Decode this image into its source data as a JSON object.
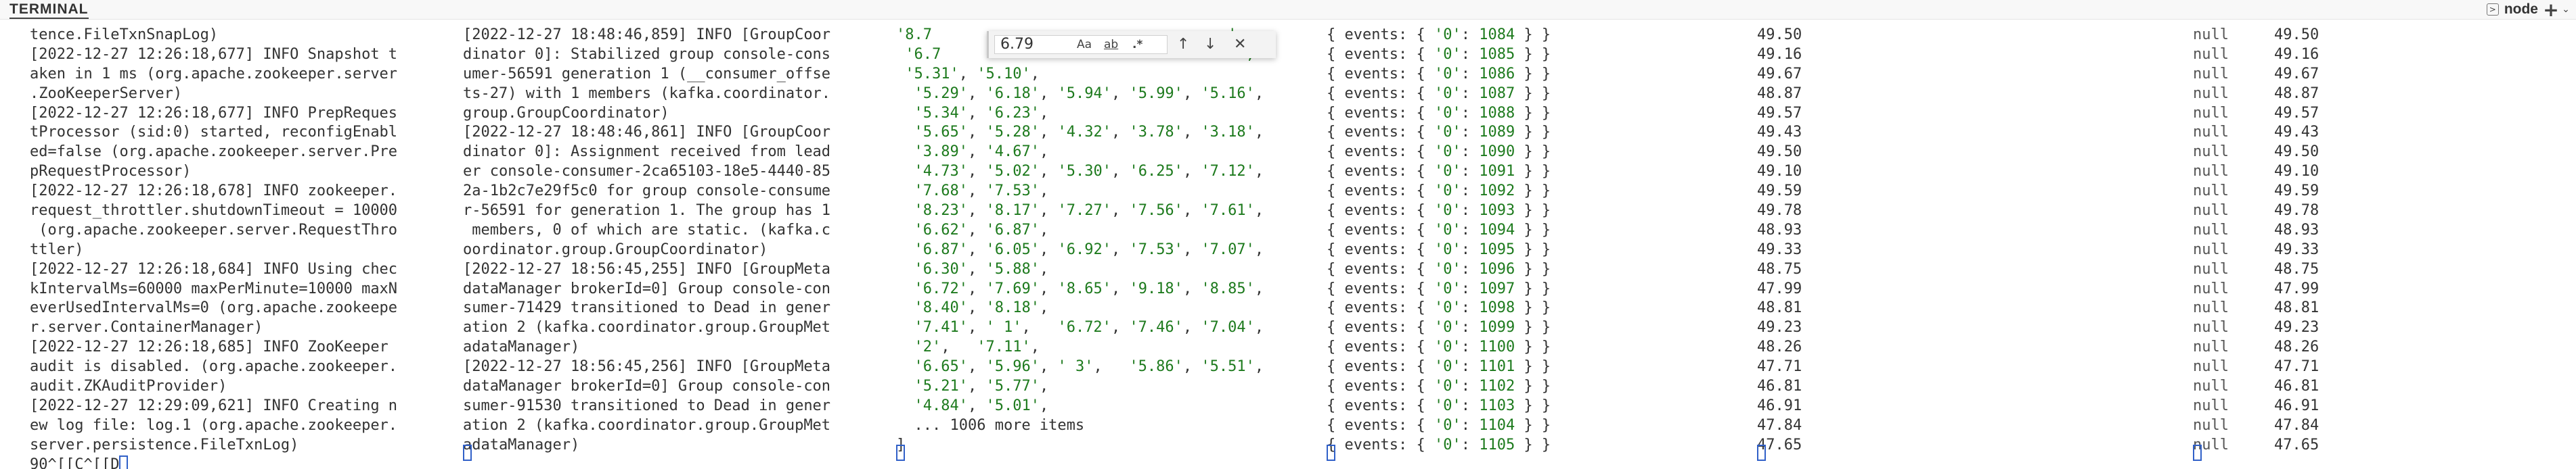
{
  "header": {
    "title": "TERMINAL",
    "shell_name": "node",
    "icons": [
      "terminal-select-icon",
      "plus-icon",
      "chevron-down-icon"
    ]
  },
  "find": {
    "query": "6.79",
    "match_case": "Aa",
    "whole_word": "ab",
    "regex": ".*",
    "prev": "↑",
    "next": "↓",
    "close": "✕"
  },
  "pane1": [
    "tence.FileTxnSnapLog)",
    "[2022-12-27 12:26:18,677] INFO Snapshot t",
    "aken in 1 ms (org.apache.zookeeper.server",
    ".ZooKeeperServer)",
    "[2022-12-27 12:26:18,677] INFO PrepReques",
    "tProcessor (sid:0) started, reconfigEnabl",
    "ed=false (org.apache.zookeeper.server.Pre",
    "pRequestProcessor)",
    "[2022-12-27 12:26:18,678] INFO zookeeper.",
    "request_throttler.shutdownTimeout = 10000",
    " (org.apache.zookeeper.server.RequestThro",
    "ttler)",
    "[2022-12-27 12:26:18,684] INFO Using chec",
    "kIntervalMs=60000 maxPerMinute=10000 maxN",
    "everUsedIntervalMs=0 (org.apache.zookeepe",
    "r.server.ContainerManager)",
    "[2022-12-27 12:26:18,685] INFO ZooKeeper",
    "audit is disabled. (org.apache.zookeeper.",
    "audit.ZKAuditProvider)",
    "[2022-12-27 12:29:09,621] INFO Creating n",
    "ew log file: log.1 (org.apache.zookeeper.",
    "server.persistence.FileTxnLog)",
    "90^[[C^[[D"
  ],
  "pane2": [
    "[2022-12-27 18:48:46,859] INFO [GroupCoor",
    "dinator 0]: Stabilized group console-cons",
    "umer-56591 generation 1 (__consumer_offse",
    "ts-27) with 1 members (kafka.coordinator.",
    "group.GroupCoordinator)",
    "[2022-12-27 18:48:46,861] INFO [GroupCoor",
    "dinator 0]: Assignment received from lead",
    "er console-consumer-2ca65103-18e5-4440-85",
    "2a-1b2c7e29f5c0 for group console-consume",
    "r-56591 for generation 1. The group has 1",
    " members, 0 of which are static. (kafka.c",
    "oordinator.group.GroupCoordinator)",
    "[2022-12-27 18:56:45,255] INFO [GroupMeta",
    "dataManager brokerId=0] Group console-con",
    "sumer-71429 transitioned to Dead in gener",
    "ation 2 (kafka.coordinator.group.GroupMet",
    "adataManager)",
    "[2022-12-27 18:56:45,256] INFO [GroupMeta",
    "dataManager brokerId=0] Group console-con",
    "sumer-91530 transitioned to Dead in gener",
    "ation 2 (kafka.coordinator.group.GroupMet",
    "adataManager)"
  ],
  "pane3": [
    [
      [
        "s",
        "'8.7"
      ],
      [
        "p",
        "                                 "
      ],
      [
        "s",
        "',"
      ]
    ],
    [
      [
        "p",
        " "
      ],
      [
        "s",
        "'6.7"
      ],
      [
        "p",
        "                                 "
      ],
      [
        "s",
        "',"
      ]
    ],
    [
      [
        "p",
        " "
      ],
      [
        "s",
        "'5.31'"
      ],
      [
        "p",
        ", "
      ],
      [
        "s",
        "'5.10'"
      ],
      [
        "p",
        ","
      ]
    ],
    [
      [
        "p",
        "  "
      ],
      [
        "s",
        "'5.29'"
      ],
      [
        "p",
        ", "
      ],
      [
        "s",
        "'6.18'"
      ],
      [
        "p",
        ", "
      ],
      [
        "s",
        "'5.94'"
      ],
      [
        "p",
        ", "
      ],
      [
        "s",
        "'5.99'"
      ],
      [
        "p",
        ", "
      ],
      [
        "s",
        "'5.16'"
      ],
      [
        "p",
        ","
      ]
    ],
    [
      [
        "p",
        "  "
      ],
      [
        "s",
        "'5.34'"
      ],
      [
        "p",
        ", "
      ],
      [
        "s",
        "'6.23'"
      ],
      [
        "p",
        ","
      ]
    ],
    [
      [
        "p",
        "  "
      ],
      [
        "s",
        "'5.65'"
      ],
      [
        "p",
        ", "
      ],
      [
        "s",
        "'5.28'"
      ],
      [
        "p",
        ", "
      ],
      [
        "s",
        "'4.32'"
      ],
      [
        "p",
        ", "
      ],
      [
        "s",
        "'3.78'"
      ],
      [
        "p",
        ", "
      ],
      [
        "s",
        "'3.18'"
      ],
      [
        "p",
        ","
      ]
    ],
    [
      [
        "p",
        "  "
      ],
      [
        "s",
        "'3.89'"
      ],
      [
        "p",
        ", "
      ],
      [
        "s",
        "'4.67'"
      ],
      [
        "p",
        ","
      ]
    ],
    [
      [
        "p",
        "  "
      ],
      [
        "s",
        "'4.73'"
      ],
      [
        "p",
        ", "
      ],
      [
        "s",
        "'5.02'"
      ],
      [
        "p",
        ", "
      ],
      [
        "s",
        "'5.30'"
      ],
      [
        "p",
        ", "
      ],
      [
        "s",
        "'6.25'"
      ],
      [
        "p",
        ", "
      ],
      [
        "s",
        "'7.12'"
      ],
      [
        "p",
        ","
      ]
    ],
    [
      [
        "p",
        "  "
      ],
      [
        "s",
        "'7.68'"
      ],
      [
        "p",
        ", "
      ],
      [
        "s",
        "'7.53'"
      ],
      [
        "p",
        ","
      ]
    ],
    [
      [
        "p",
        "  "
      ],
      [
        "s",
        "'8.23'"
      ],
      [
        "p",
        ", "
      ],
      [
        "s",
        "'8.17'"
      ],
      [
        "p",
        ", "
      ],
      [
        "s",
        "'7.27'"
      ],
      [
        "p",
        ", "
      ],
      [
        "s",
        "'7.56'"
      ],
      [
        "p",
        ", "
      ],
      [
        "s",
        "'7.61'"
      ],
      [
        "p",
        ","
      ]
    ],
    [
      [
        "p",
        "  "
      ],
      [
        "s",
        "'6.62'"
      ],
      [
        "p",
        ", "
      ],
      [
        "s",
        "'6.87'"
      ],
      [
        "p",
        ","
      ]
    ],
    [
      [
        "p",
        "  "
      ],
      [
        "s",
        "'6.87'"
      ],
      [
        "p",
        ", "
      ],
      [
        "s",
        "'6.05'"
      ],
      [
        "p",
        ", "
      ],
      [
        "s",
        "'6.92'"
      ],
      [
        "p",
        ", "
      ],
      [
        "s",
        "'7.53'"
      ],
      [
        "p",
        ", "
      ],
      [
        "s",
        "'7.07'"
      ],
      [
        "p",
        ","
      ]
    ],
    [
      [
        "p",
        "  "
      ],
      [
        "s",
        "'6.30'"
      ],
      [
        "p",
        ", "
      ],
      [
        "s",
        "'5.88'"
      ],
      [
        "p",
        ","
      ]
    ],
    [
      [
        "p",
        "  "
      ],
      [
        "s",
        "'6.72'"
      ],
      [
        "p",
        ", "
      ],
      [
        "s",
        "'7.69'"
      ],
      [
        "p",
        ", "
      ],
      [
        "s",
        "'8.65'"
      ],
      [
        "p",
        ", "
      ],
      [
        "s",
        "'9.18'"
      ],
      [
        "p",
        ", "
      ],
      [
        "s",
        "'8.85'"
      ],
      [
        "p",
        ","
      ]
    ],
    [
      [
        "p",
        "  "
      ],
      [
        "s",
        "'8.40'"
      ],
      [
        "p",
        ", "
      ],
      [
        "s",
        "'8.18'"
      ],
      [
        "p",
        ","
      ]
    ],
    [
      [
        "p",
        "  "
      ],
      [
        "s",
        "'7.41'"
      ],
      [
        "p",
        ", "
      ],
      [
        "s",
        "' 1'"
      ],
      [
        "p",
        ",   "
      ],
      [
        "s",
        "'6.72'"
      ],
      [
        "p",
        ", "
      ],
      [
        "s",
        "'7.46'"
      ],
      [
        "p",
        ", "
      ],
      [
        "s",
        "'7.04'"
      ],
      [
        "p",
        ","
      ]
    ],
    [
      [
        "p",
        "  "
      ],
      [
        "s",
        "'2'"
      ],
      [
        "p",
        ",   "
      ],
      [
        "s",
        "'7.11'"
      ],
      [
        "p",
        ","
      ]
    ],
    [
      [
        "p",
        "  "
      ],
      [
        "s",
        "'6.65'"
      ],
      [
        "p",
        ", "
      ],
      [
        "s",
        "'5.96'"
      ],
      [
        "p",
        ", "
      ],
      [
        "s",
        "' 3'"
      ],
      [
        "p",
        ",   "
      ],
      [
        "s",
        "'5.86'"
      ],
      [
        "p",
        ", "
      ],
      [
        "s",
        "'5.51'"
      ],
      [
        "p",
        ","
      ]
    ],
    [
      [
        "p",
        "  "
      ],
      [
        "s",
        "'5.21'"
      ],
      [
        "p",
        ", "
      ],
      [
        "s",
        "'5.77'"
      ],
      [
        "p",
        ","
      ]
    ],
    [
      [
        "p",
        "  "
      ],
      [
        "s",
        "'4.84'"
      ],
      [
        "p",
        ", "
      ],
      [
        "s",
        "'5.01'"
      ],
      [
        "p",
        ","
      ]
    ],
    [
      [
        "p",
        "  ... 1006 more items"
      ]
    ],
    [
      [
        "p",
        "]"
      ]
    ]
  ],
  "pane4": {
    "prefix": "{ events: { ",
    "key": "'0'",
    "ids": [
      "1084",
      "1085",
      "1086",
      "1087",
      "1088",
      "1089",
      "1090",
      "1091",
      "1092",
      "1093",
      "1094",
      "1095",
      "1096",
      "1097",
      "1098",
      "1099",
      "1100",
      "1101",
      "1102",
      "1103",
      "1104",
      "1105"
    ],
    "suffix": " } }"
  },
  "pane5": [
    "49.50",
    "49.16",
    "49.67",
    "48.87",
    "49.57",
    "49.43",
    "49.50",
    "49.10",
    "49.59",
    "49.78",
    "48.93",
    "49.33",
    "48.75",
    "47.99",
    "48.81",
    "49.23",
    "48.26",
    "47.71",
    "46.81",
    "46.91",
    "47.84",
    "47.65"
  ],
  "pane6": {
    "null_label": "null",
    "values": [
      "49.50",
      "49.16",
      "49.67",
      "48.87",
      "49.57",
      "49.43",
      "49.50",
      "49.10",
      "49.59",
      "49.78",
      "48.93",
      "49.33",
      "48.75",
      "47.99",
      "48.81",
      "49.23",
      "48.26",
      "47.71",
      "46.81",
      "46.91",
      "47.84",
      "47.65"
    ]
  },
  "colors": {
    "string": "#1d7a1d",
    "key": "#0b6bcb",
    "cursor": "#3060c8"
  }
}
